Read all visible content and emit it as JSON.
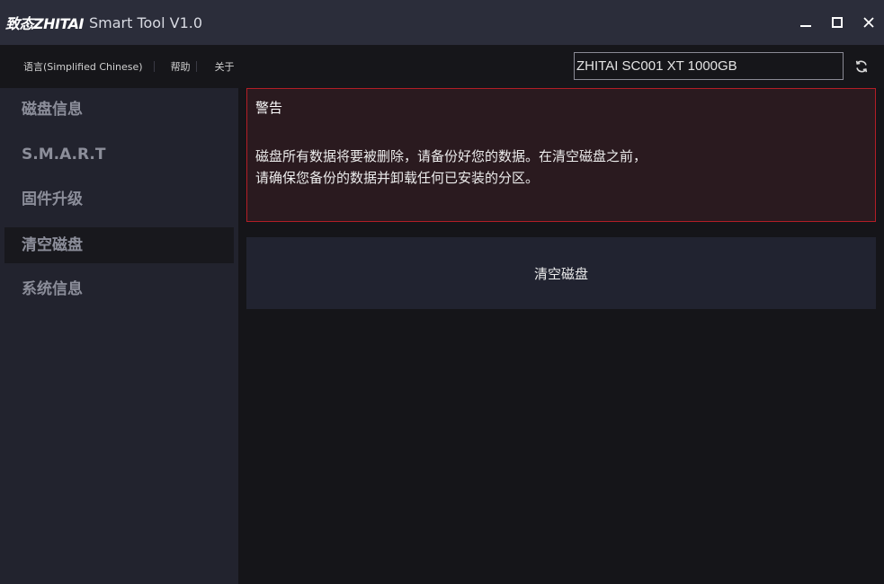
{
  "window": {
    "logo_text": "致态ZHITAI",
    "title": "Smart Tool V1.0",
    "minimize_icon": "minimize-icon",
    "maximize_icon": "maximize-icon",
    "close_icon": "close-icon"
  },
  "menu": {
    "items": [
      {
        "label": "语言(Simplified Chinese)"
      },
      {
        "label": "帮助"
      },
      {
        "label": "关于"
      }
    ],
    "device": "ZHITAI SC001 XT 1000GB",
    "refresh_icon": "refresh-icon"
  },
  "sidebar": {
    "items": [
      {
        "label": "磁盘信息",
        "active": false
      },
      {
        "label": "S.M.A.R.T",
        "active": false
      },
      {
        "label": "固件升级",
        "active": false
      },
      {
        "label": "清空磁盘",
        "active": true
      },
      {
        "label": "系统信息",
        "active": false
      }
    ]
  },
  "warning": {
    "title": "警告",
    "line1": "磁盘所有数据将要被删除，请备份好您的数据。在清空磁盘之前，",
    "line2": "请确保您备份的数据并卸载任何已安装的分区。",
    "border_color": "#b21e26"
  },
  "action": {
    "label": "清空磁盘"
  }
}
